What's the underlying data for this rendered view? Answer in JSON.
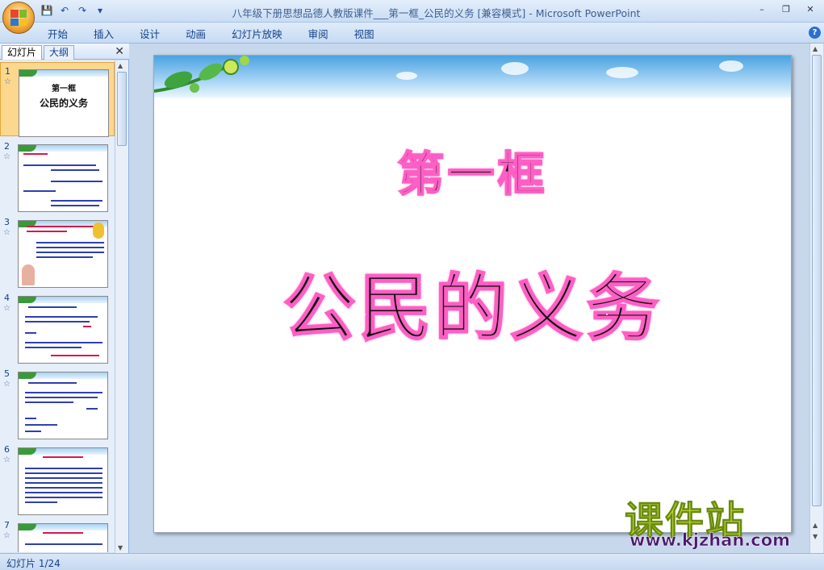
{
  "window": {
    "title": "八年级下册思想品德人教版课件___第一框_公民的义务 [兼容模式] - Microsoft PowerPoint",
    "controls": [
      "–",
      "❐",
      "✕"
    ]
  },
  "qat": {
    "save": "💾",
    "undo": "↶",
    "redo": "↷",
    "customize": "▾"
  },
  "ribbon": {
    "tabs": [
      "开始",
      "插入",
      "设计",
      "动画",
      "幻灯片放映",
      "审阅",
      "视图"
    ],
    "help": "?"
  },
  "pane": {
    "tabs": [
      "幻灯片",
      "大纲"
    ],
    "close": "✕",
    "slides": [
      {
        "num": "1",
        "selected": true
      },
      {
        "num": "2",
        "selected": false
      },
      {
        "num": "3",
        "selected": false
      },
      {
        "num": "4",
        "selected": false
      },
      {
        "num": "5",
        "selected": false
      },
      {
        "num": "6",
        "selected": false
      },
      {
        "num": "7",
        "selected": false
      }
    ],
    "thumb1_line1": "第一框",
    "thumb1_line2": "公民的义务",
    "anim_glyph": "☆"
  },
  "slide": {
    "title": "第一框",
    "subtitle": "公民的义务"
  },
  "watermark": {
    "name": "课件站",
    "url": "www.kjzhan.com"
  },
  "status": {
    "slide_counter": "幻灯片 1/24"
  },
  "colors": {
    "ribbon": "#c7dbf3",
    "title_glow": "#ff5ec4",
    "watermark_green": "#c8e23a",
    "watermark_purple": "#4b1a6e",
    "selection": "#fbd88d"
  }
}
